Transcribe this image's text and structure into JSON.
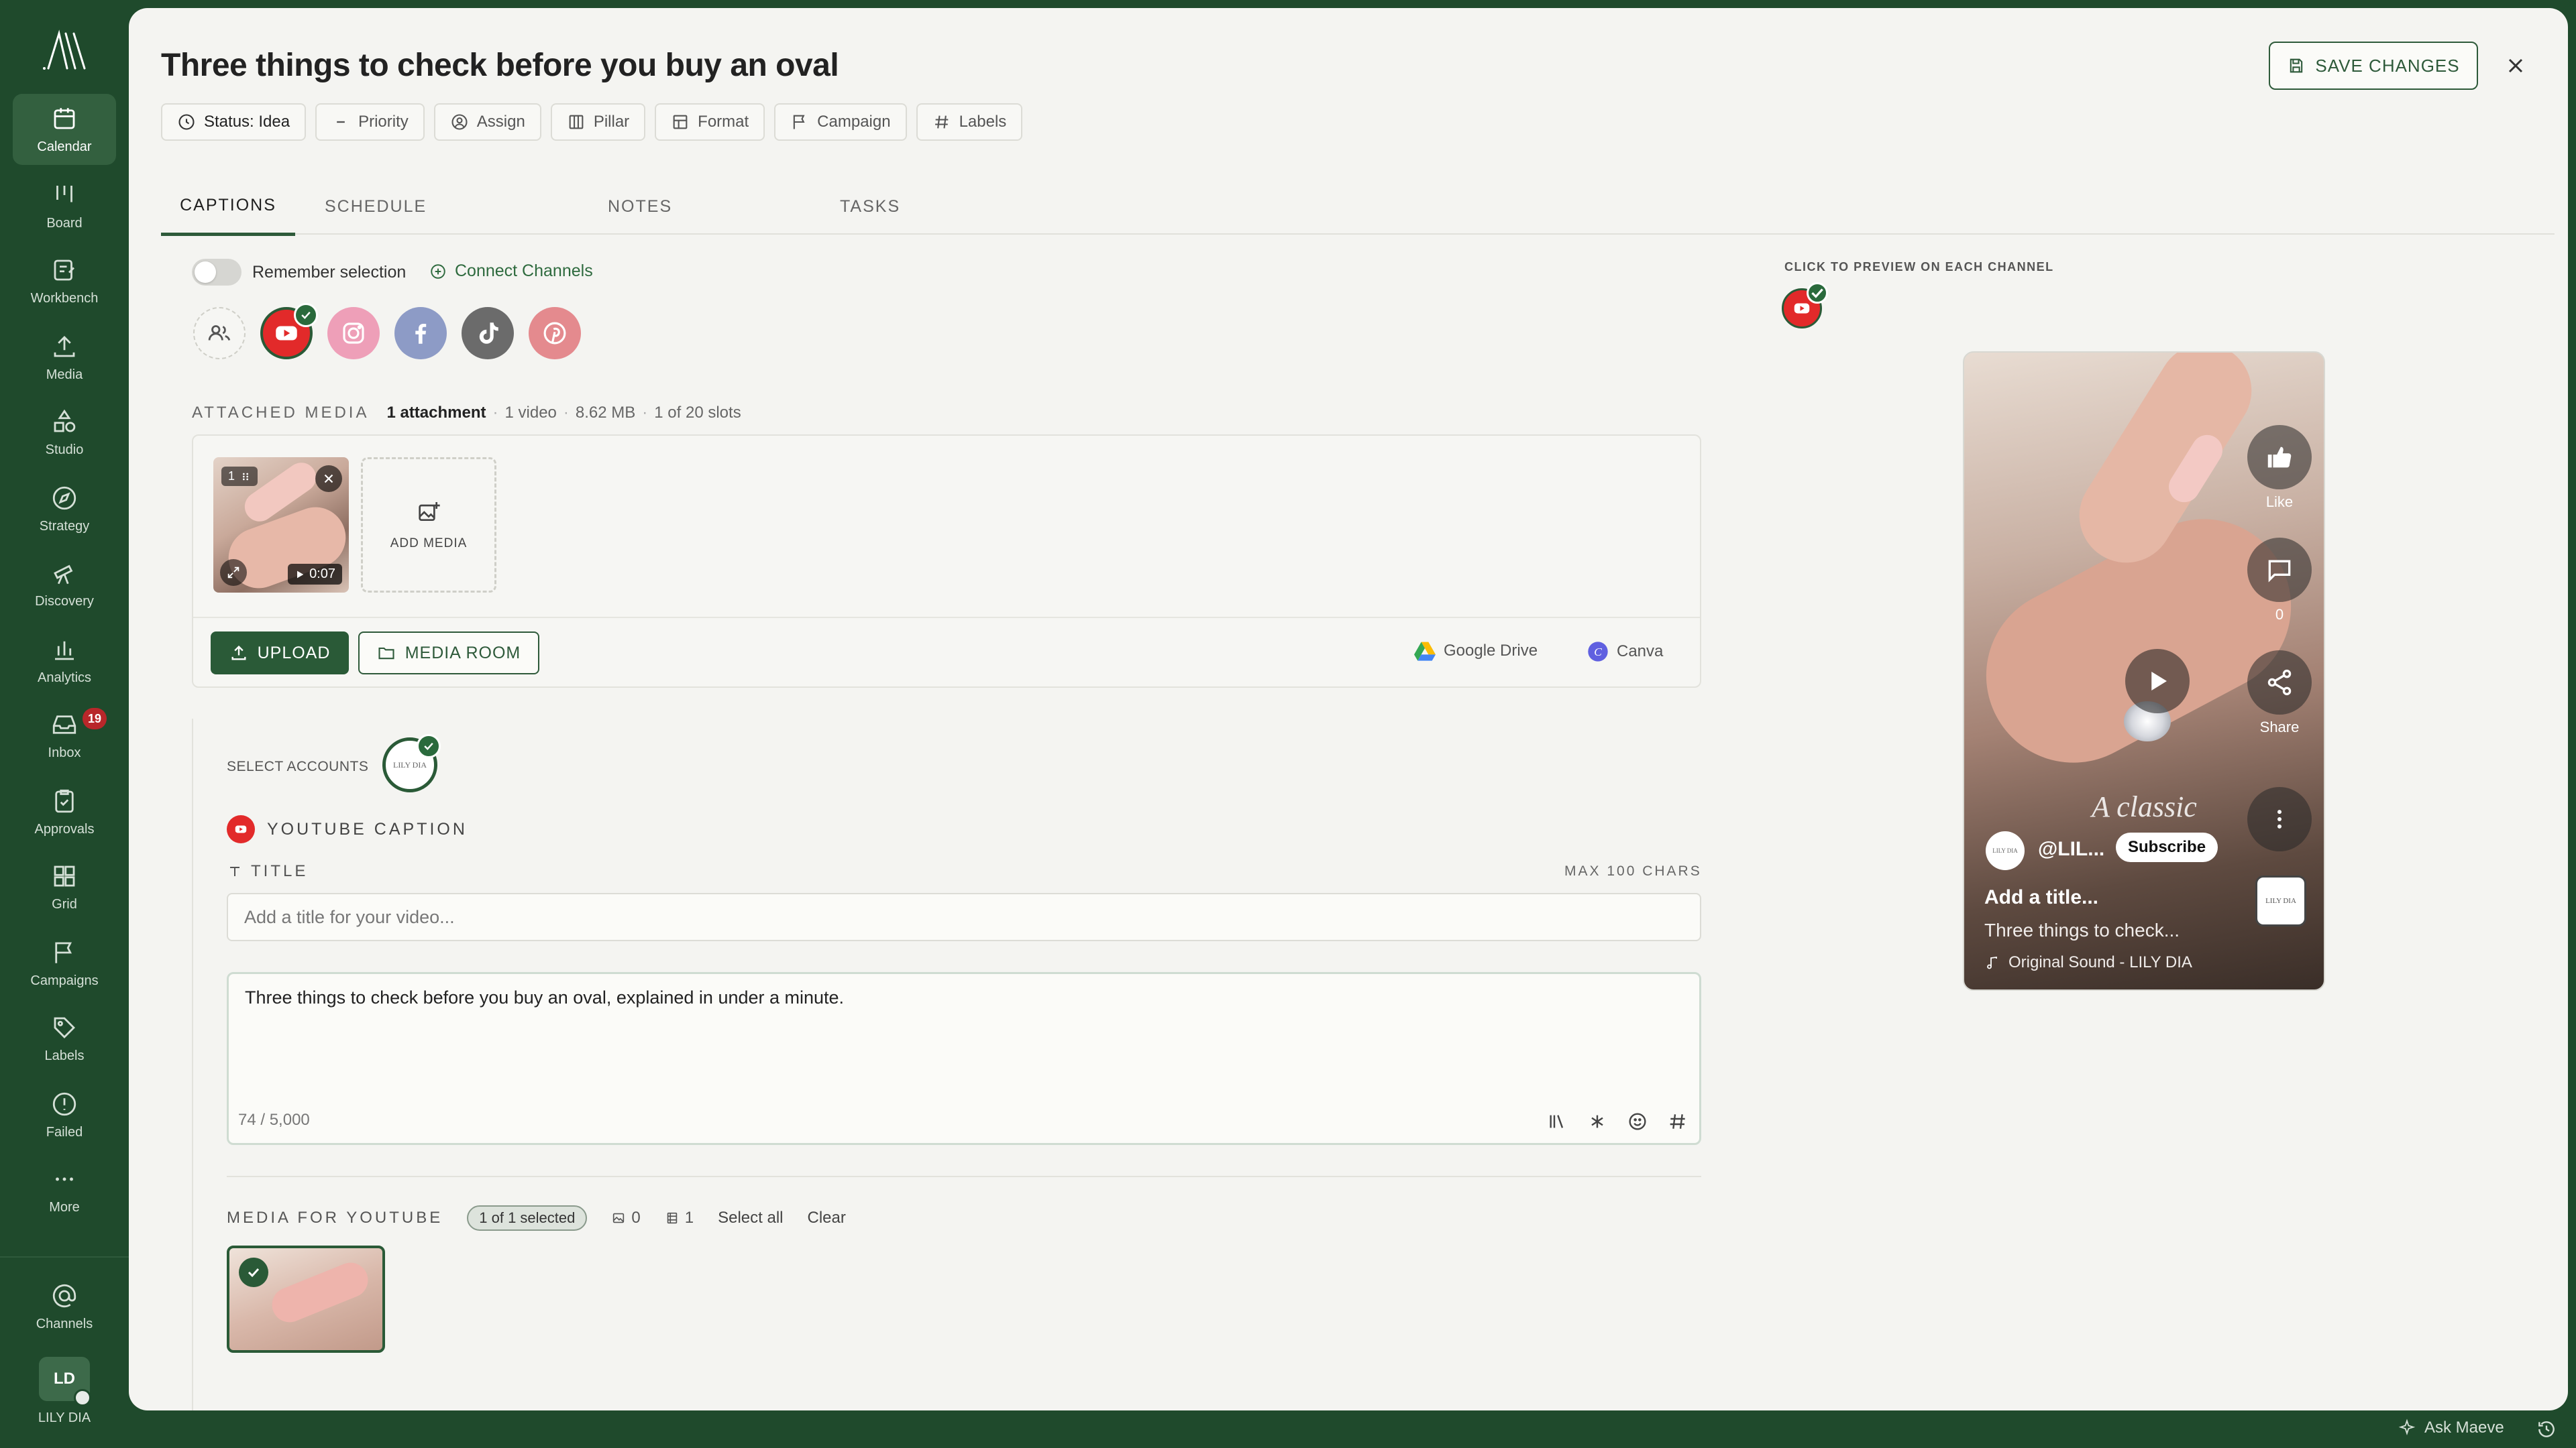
{
  "sidebar": {
    "items": [
      {
        "label": "Calendar",
        "icon": "calendar-icon",
        "active": true
      },
      {
        "label": "Board",
        "icon": "board-icon"
      },
      {
        "label": "Workbench",
        "icon": "workbench-icon"
      },
      {
        "label": "Media",
        "icon": "upload-icon"
      },
      {
        "label": "Studio",
        "icon": "shapes-icon"
      },
      {
        "label": "Strategy",
        "icon": "compass-icon"
      },
      {
        "label": "Discovery",
        "icon": "telescope-icon"
      },
      {
        "label": "Analytics",
        "icon": "bar-chart-icon"
      },
      {
        "label": "Inbox",
        "icon": "inbox-icon",
        "badge": "19"
      },
      {
        "label": "Approvals",
        "icon": "clipboard-check-icon"
      },
      {
        "label": "Grid",
        "icon": "grid-icon"
      },
      {
        "label": "Campaigns",
        "icon": "flag-icon"
      },
      {
        "label": "Labels",
        "icon": "tag-icon"
      },
      {
        "label": "Failed",
        "icon": "alert-circle-icon"
      },
      {
        "label": "More",
        "icon": "more-dots-icon"
      }
    ],
    "channels_label": "Channels",
    "user": {
      "initials": "LD",
      "name": "LILY DIA"
    }
  },
  "header": {
    "title": "Three things to check before you buy an oval",
    "save_label": "SAVE CHANGES"
  },
  "chips": [
    {
      "label": "Status: Idea",
      "icon": "status-circle-icon"
    },
    {
      "label": "Priority",
      "icon": "minus-icon"
    },
    {
      "label": "Assign",
      "icon": "user-circle-icon"
    },
    {
      "label": "Pillar",
      "icon": "columns-icon"
    },
    {
      "label": "Format",
      "icon": "layout-icon"
    },
    {
      "label": "Campaign",
      "icon": "flag-icon"
    },
    {
      "label": "Labels",
      "icon": "hash-icon"
    }
  ],
  "tabs": [
    "CAPTIONS",
    "SCHEDULE",
    "NOTES",
    "TASKS"
  ],
  "captions": {
    "remember_label": "Remember selection",
    "connect_label": "Connect Channels",
    "channels": [
      "group",
      "youtube",
      "instagram",
      "facebook",
      "tiktok",
      "pinterest"
    ],
    "attached": {
      "label": "ATTACHED MEDIA",
      "count": "1 attachment",
      "type": "1 video",
      "size": "8.62 MB",
      "slots": "1 of 20 slots"
    },
    "thumb_index": "1",
    "thumb_duration": "0:07",
    "add_media": "ADD MEDIA",
    "upload": "UPLOAD",
    "media_room": "MEDIA ROOM",
    "google_drive": "Google Drive",
    "canva": "Canva",
    "select_accounts": "SELECT ACCOUNTS",
    "account_initials": "LILY DIA",
    "youtube_caption": "YOUTUBE CAPTION",
    "title_label": "TITLE",
    "max_chars": "MAX 100 CHARS",
    "title_placeholder": "Add a title for your video...",
    "caption_text": "Three things to check before you buy an oval, explained in under a minute.",
    "char_count": "74 / 5,000",
    "media_for": "MEDIA FOR YOUTUBE",
    "selected_pill": "1 of 1 selected",
    "image_count": "0",
    "video_count": "1",
    "select_all": "Select all",
    "clear": "Clear"
  },
  "preview": {
    "label": "CLICK TO PREVIEW ON EACH CHANNEL",
    "like": "Like",
    "comments": "0",
    "share": "Share",
    "script_text": "A classic",
    "handle": "@LIL...",
    "subscribe": "Subscribe",
    "title": "Add a title...",
    "desc": "Three things to check...",
    "sound": "Original Sound - LILY DIA",
    "avatar_text": "LILY DIA"
  },
  "footer": {
    "ask": "Ask Maeve"
  },
  "colors": {
    "brand": "#1f4a2c",
    "accent": "#2a5a37",
    "youtube": "#e22a2a"
  }
}
